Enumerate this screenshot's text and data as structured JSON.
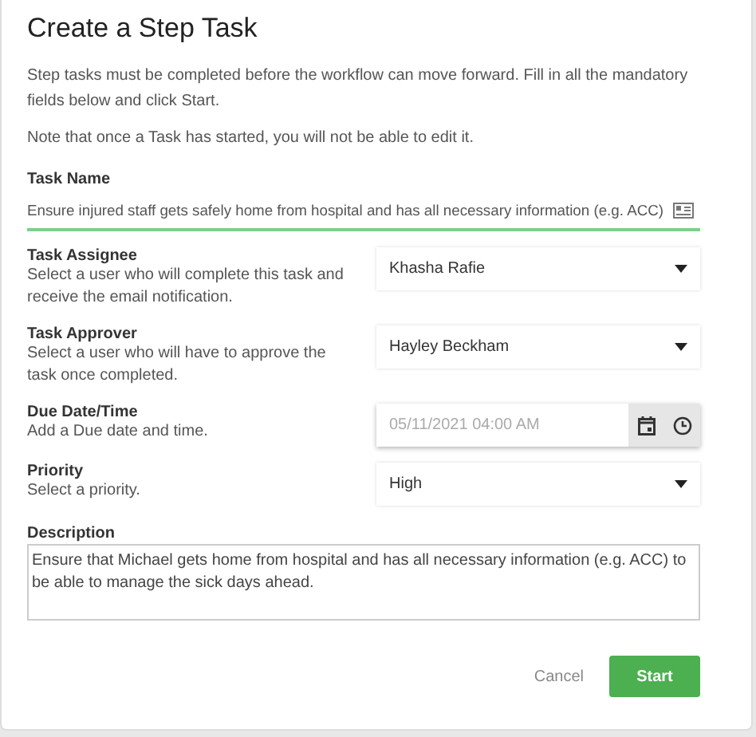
{
  "dialog": {
    "title": "Create a Step Task",
    "intro": [
      "Step tasks must be completed before the workflow can move forward. Fill in all the mandatory fields below and click Start.",
      "Note that once a Task has started, you will not be able to edit it."
    ],
    "task_name": {
      "label": "Task Name",
      "value": "Ensure injured staff gets safely home from hospital and has all necessary information (e.g. ACC)"
    },
    "fields": [
      {
        "kind": "select",
        "label": "Task Assignee",
        "hint": "Select a user who will complete this task and receive the email notification.",
        "value": "Khasha Rafie"
      },
      {
        "kind": "select",
        "label": "Task Approver",
        "hint": "Select a user who will have to approve the task once completed.",
        "value": "Hayley Beckham"
      },
      {
        "kind": "datetime",
        "label": "Due Date/Time",
        "hint": "Add a Due date and time.",
        "placeholder": "05/11/2021 04:00 AM"
      },
      {
        "kind": "select",
        "label": "Priority",
        "hint": "Select a priority.",
        "value": "High"
      }
    ],
    "description": {
      "label": "Description",
      "value": "Ensure that Michael gets home from hospital and has all necessary information (e.g. ACC) to be able to manage the sick days ahead."
    },
    "buttons": {
      "cancel": "Cancel",
      "start": "Start"
    }
  }
}
